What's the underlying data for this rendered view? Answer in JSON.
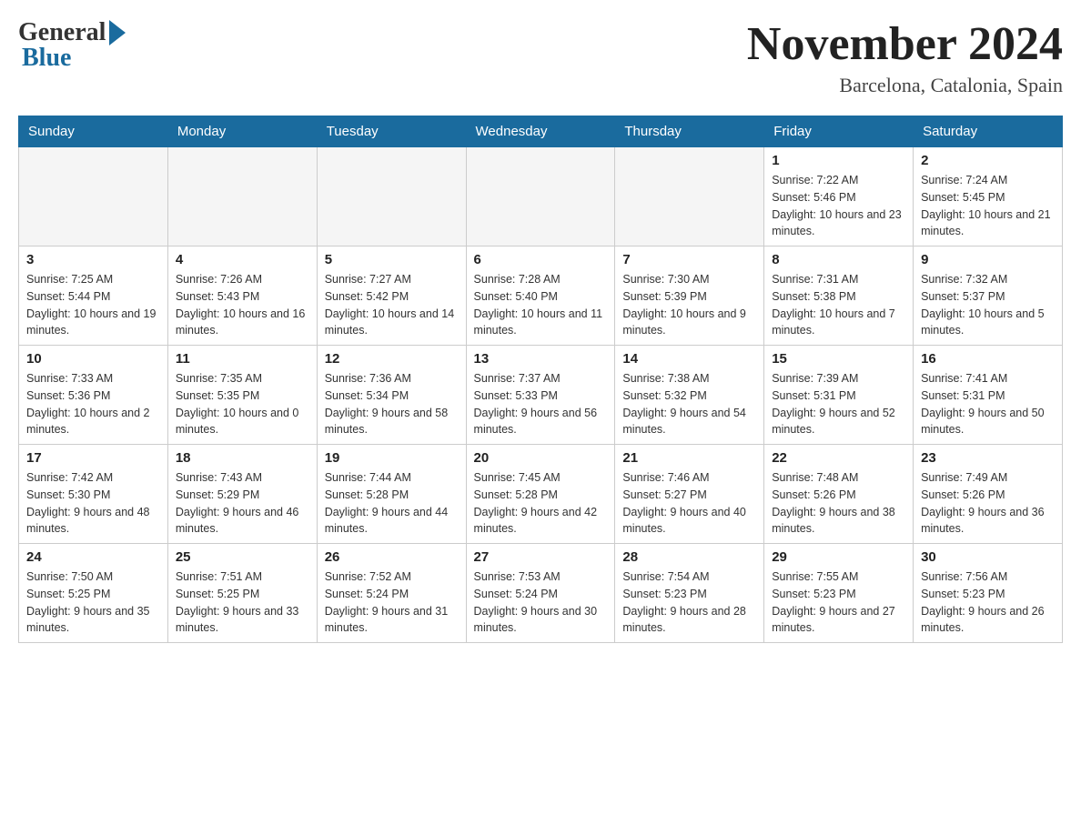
{
  "header": {
    "logo_general": "General",
    "logo_blue": "Blue",
    "month_title": "November 2024",
    "location": "Barcelona, Catalonia, Spain"
  },
  "days_of_week": [
    "Sunday",
    "Monday",
    "Tuesday",
    "Wednesday",
    "Thursday",
    "Friday",
    "Saturday"
  ],
  "weeks": [
    {
      "days": [
        {
          "num": "",
          "info": ""
        },
        {
          "num": "",
          "info": ""
        },
        {
          "num": "",
          "info": ""
        },
        {
          "num": "",
          "info": ""
        },
        {
          "num": "",
          "info": ""
        },
        {
          "num": "1",
          "info": "Sunrise: 7:22 AM\nSunset: 5:46 PM\nDaylight: 10 hours and 23 minutes."
        },
        {
          "num": "2",
          "info": "Sunrise: 7:24 AM\nSunset: 5:45 PM\nDaylight: 10 hours and 21 minutes."
        }
      ]
    },
    {
      "days": [
        {
          "num": "3",
          "info": "Sunrise: 7:25 AM\nSunset: 5:44 PM\nDaylight: 10 hours and 19 minutes."
        },
        {
          "num": "4",
          "info": "Sunrise: 7:26 AM\nSunset: 5:43 PM\nDaylight: 10 hours and 16 minutes."
        },
        {
          "num": "5",
          "info": "Sunrise: 7:27 AM\nSunset: 5:42 PM\nDaylight: 10 hours and 14 minutes."
        },
        {
          "num": "6",
          "info": "Sunrise: 7:28 AM\nSunset: 5:40 PM\nDaylight: 10 hours and 11 minutes."
        },
        {
          "num": "7",
          "info": "Sunrise: 7:30 AM\nSunset: 5:39 PM\nDaylight: 10 hours and 9 minutes."
        },
        {
          "num": "8",
          "info": "Sunrise: 7:31 AM\nSunset: 5:38 PM\nDaylight: 10 hours and 7 minutes."
        },
        {
          "num": "9",
          "info": "Sunrise: 7:32 AM\nSunset: 5:37 PM\nDaylight: 10 hours and 5 minutes."
        }
      ]
    },
    {
      "days": [
        {
          "num": "10",
          "info": "Sunrise: 7:33 AM\nSunset: 5:36 PM\nDaylight: 10 hours and 2 minutes."
        },
        {
          "num": "11",
          "info": "Sunrise: 7:35 AM\nSunset: 5:35 PM\nDaylight: 10 hours and 0 minutes."
        },
        {
          "num": "12",
          "info": "Sunrise: 7:36 AM\nSunset: 5:34 PM\nDaylight: 9 hours and 58 minutes."
        },
        {
          "num": "13",
          "info": "Sunrise: 7:37 AM\nSunset: 5:33 PM\nDaylight: 9 hours and 56 minutes."
        },
        {
          "num": "14",
          "info": "Sunrise: 7:38 AM\nSunset: 5:32 PM\nDaylight: 9 hours and 54 minutes."
        },
        {
          "num": "15",
          "info": "Sunrise: 7:39 AM\nSunset: 5:31 PM\nDaylight: 9 hours and 52 minutes."
        },
        {
          "num": "16",
          "info": "Sunrise: 7:41 AM\nSunset: 5:31 PM\nDaylight: 9 hours and 50 minutes."
        }
      ]
    },
    {
      "days": [
        {
          "num": "17",
          "info": "Sunrise: 7:42 AM\nSunset: 5:30 PM\nDaylight: 9 hours and 48 minutes."
        },
        {
          "num": "18",
          "info": "Sunrise: 7:43 AM\nSunset: 5:29 PM\nDaylight: 9 hours and 46 minutes."
        },
        {
          "num": "19",
          "info": "Sunrise: 7:44 AM\nSunset: 5:28 PM\nDaylight: 9 hours and 44 minutes."
        },
        {
          "num": "20",
          "info": "Sunrise: 7:45 AM\nSunset: 5:28 PM\nDaylight: 9 hours and 42 minutes."
        },
        {
          "num": "21",
          "info": "Sunrise: 7:46 AM\nSunset: 5:27 PM\nDaylight: 9 hours and 40 minutes."
        },
        {
          "num": "22",
          "info": "Sunrise: 7:48 AM\nSunset: 5:26 PM\nDaylight: 9 hours and 38 minutes."
        },
        {
          "num": "23",
          "info": "Sunrise: 7:49 AM\nSunset: 5:26 PM\nDaylight: 9 hours and 36 minutes."
        }
      ]
    },
    {
      "days": [
        {
          "num": "24",
          "info": "Sunrise: 7:50 AM\nSunset: 5:25 PM\nDaylight: 9 hours and 35 minutes."
        },
        {
          "num": "25",
          "info": "Sunrise: 7:51 AM\nSunset: 5:25 PM\nDaylight: 9 hours and 33 minutes."
        },
        {
          "num": "26",
          "info": "Sunrise: 7:52 AM\nSunset: 5:24 PM\nDaylight: 9 hours and 31 minutes."
        },
        {
          "num": "27",
          "info": "Sunrise: 7:53 AM\nSunset: 5:24 PM\nDaylight: 9 hours and 30 minutes."
        },
        {
          "num": "28",
          "info": "Sunrise: 7:54 AM\nSunset: 5:23 PM\nDaylight: 9 hours and 28 minutes."
        },
        {
          "num": "29",
          "info": "Sunrise: 7:55 AM\nSunset: 5:23 PM\nDaylight: 9 hours and 27 minutes."
        },
        {
          "num": "30",
          "info": "Sunrise: 7:56 AM\nSunset: 5:23 PM\nDaylight: 9 hours and 26 minutes."
        }
      ]
    }
  ]
}
